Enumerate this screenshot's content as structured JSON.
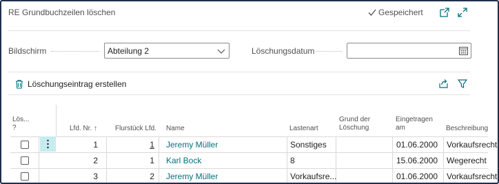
{
  "header": {
    "title": "RE Grundbuchzeilen löschen",
    "saved_label": "Gespeichert"
  },
  "fields": {
    "bildschirm_label": "Bildschirm",
    "bildschirm_value": "Abteilung 2",
    "loeschungsdatum_label": "Löschungsdatum",
    "loeschungsdatum_value": ""
  },
  "actions": {
    "create_label": "Löschungseintrag erstellen"
  },
  "table": {
    "columns": {
      "loeschen": "Lös...\n?",
      "lfd_nr": "Lfd. Nr.",
      "flurstueck": "Flurstück Lfd.",
      "name": "Name",
      "lastenart": "Lastenart",
      "grund": "Grund der\nLöschung",
      "eingetragen": "Eingetragen\nam",
      "beschreibung": "Beschreibung"
    },
    "sort_indicator": "↑",
    "rows": [
      {
        "lfd_nr": "1",
        "flurstueck": "1",
        "name": "Jeremy Müller",
        "lastenart": "Sonstiges",
        "grund": "",
        "eingetragen": "01.06.2000",
        "beschreibung": "Vorkaufsrecht"
      },
      {
        "lfd_nr": "2",
        "flurstueck": "1",
        "name": "Karl Bock",
        "lastenart": "8",
        "grund": "",
        "eingetragen": "15.06.2000",
        "beschreibung": "Wegerecht"
      },
      {
        "lfd_nr": "3",
        "flurstueck": "2",
        "name": "Jeremy Müller",
        "lastenart": "Vorkaufsre...",
        "grund": "",
        "eingetragen": "01.06.2000",
        "beschreibung": "Vorkaufsrecht"
      }
    ]
  },
  "colors": {
    "accent": "#00717a",
    "frame": "#1f2f4e",
    "selected_cell": "#c6ecf0"
  }
}
